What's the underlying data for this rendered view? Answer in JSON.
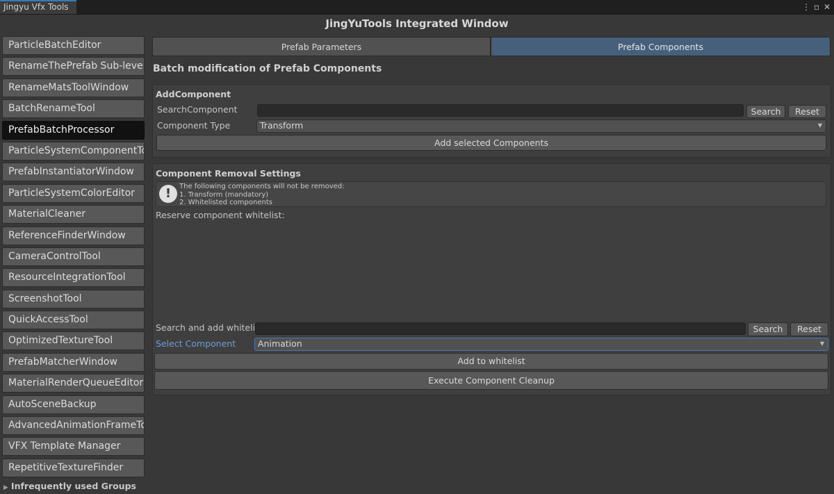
{
  "window": {
    "tab_title": "Jingyu Vfx Tools",
    "main_title": "JingYuTools Integrated Window",
    "controls": [
      "kebab-menu-icon",
      "maximize-icon",
      "close-icon"
    ]
  },
  "sidebar": {
    "items": [
      {
        "label": "ParticleBatchEditor"
      },
      {
        "label": "RenameThePrefab Sub-level"
      },
      {
        "label": "RenameMatsToolWindow"
      },
      {
        "label": "BatchRenameTool"
      },
      {
        "label": "PrefabBatchProcessor",
        "active": true
      },
      {
        "label": "ParticleSystemComponentTool"
      },
      {
        "label": "PrefabInstantiatorWindow"
      },
      {
        "label": "ParticleSystemColorEditor"
      },
      {
        "label": "MaterialCleaner"
      },
      {
        "label": "ReferenceFinderWindow"
      },
      {
        "label": "CameraControlTool"
      },
      {
        "label": "ResourceIntegrationTool"
      },
      {
        "label": "ScreenshotTool"
      },
      {
        "label": "QuickAccessTool"
      },
      {
        "label": "OptimizedTextureTool"
      },
      {
        "label": "PrefabMatcherWindow"
      },
      {
        "label": "MaterialRenderQueueEditor"
      },
      {
        "label": "AutoSceneBackup"
      },
      {
        "label": "AdvancedAnimationFrameTool"
      },
      {
        "label": "VFX Template Manager"
      },
      {
        "label": "RepetitiveTextureFinder"
      }
    ],
    "foldout_label": "Infrequently used Groups"
  },
  "tabs": [
    {
      "label": "Prefab Parameters",
      "selected": false
    },
    {
      "label": "Prefab Components",
      "selected": true
    }
  ],
  "heading": "Batch modification of Prefab Components",
  "add_component": {
    "title": "AddComponent",
    "search_label": "SearchComponent",
    "search_value": "",
    "search_button": "Search",
    "reset_button": "Reset",
    "type_label": "Component Type",
    "type_value": "Transform",
    "add_button": "Add selected Components"
  },
  "removal": {
    "title": "Component Removal Settings",
    "help_lines": [
      "The following components will not be removed:",
      "1. Transform (mandatory)",
      "2. Whitelisted components"
    ],
    "whitelist_label": "Reserve component whitelist:",
    "search_label": "Search and add whitelist",
    "search_value": "",
    "search_button": "Search",
    "reset_button": "Reset",
    "select_label": "Select Component",
    "select_value": "Animation",
    "add_whitelist_button": "Add to whitelist",
    "cleanup_button": "Execute Component Cleanup"
  },
  "colors": {
    "accent_tab": "#46607c",
    "window_tab_top": "#3a79bb",
    "selected_label": "#6f9ed8"
  }
}
